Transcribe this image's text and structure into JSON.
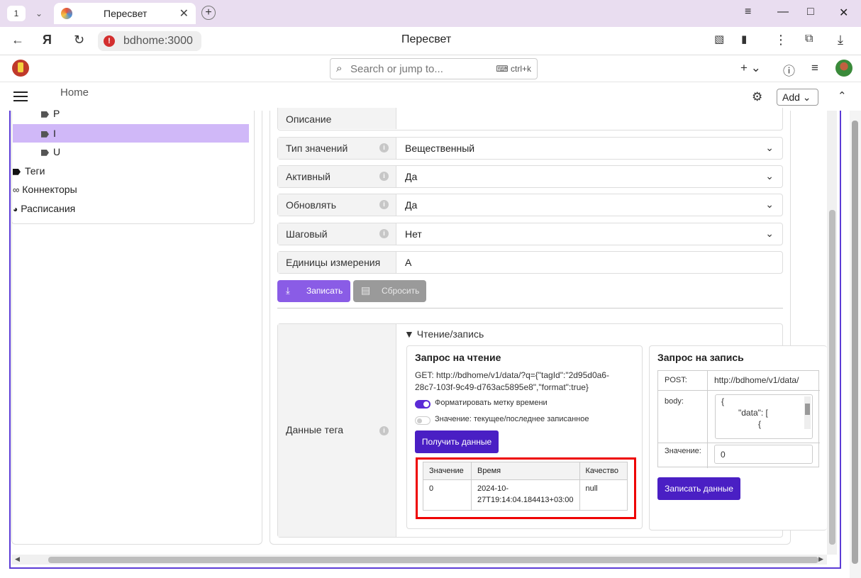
{
  "browser": {
    "tab_count": "1",
    "tab_title": "Пересвет",
    "url": "bdhome:3000",
    "page_title": "Пересвет"
  },
  "app": {
    "search_placeholder": "Search or jump to...",
    "search_shortcut": "ctrl+k",
    "breadcrumb_home": "Home",
    "add_label": "Add"
  },
  "sidebar": {
    "items": [
      {
        "label": "P",
        "icon": "tag-icon"
      },
      {
        "label": "I",
        "icon": "tag-icon"
      },
      {
        "label": "U",
        "icon": "tag-icon"
      },
      {
        "label": "Теги",
        "icon": "tags-icon"
      },
      {
        "label": "Коннекторы",
        "icon": "link-icon"
      },
      {
        "label": "Расписания",
        "icon": "clock-icon"
      }
    ]
  },
  "form": {
    "rows": [
      {
        "label": "Описание",
        "value": ""
      },
      {
        "label": "Тип значений",
        "value": "Вещественный"
      },
      {
        "label": "Активный",
        "value": "Да"
      },
      {
        "label": "Обновлять",
        "value": "Да"
      },
      {
        "label": "Шаговый",
        "value": "Нет"
      },
      {
        "label": "Единицы измерения",
        "value": "A"
      }
    ],
    "save_label": "Записать",
    "reset_label": "Сбросить"
  },
  "tag_data": {
    "label": "Данные тега",
    "summary": "Чтение/запись",
    "read": {
      "title": "Запрос на чтение",
      "get_line1": "GET:  http://bdhome/v1/data/?q={\"tagId\":\"2d95d0a6-",
      "get_line2": "28c7-103f-9c49-d763ac5895e8\",\"format\":true}",
      "toggle_format": "Форматировать метку времени",
      "toggle_value": "Значение: текущее/последнее записанное",
      "button": "Получить данные",
      "table_headers": [
        "Значение",
        "Время",
        "Качество"
      ],
      "table_row": {
        "value": "0",
        "time_1": "2024-10-",
        "time_2": "27T19:14:04.184413+03:00",
        "quality": "null"
      }
    },
    "write": {
      "title": "Запрос на запись",
      "post_label": "POST:",
      "post_url": "http://bdhome/v1/data/",
      "body_label": "body:",
      "body_line1": "{",
      "body_line2": "\"data\": [",
      "body_line3": "{",
      "value_label": "Значение:",
      "value": "0",
      "button": "Записать данные"
    }
  }
}
